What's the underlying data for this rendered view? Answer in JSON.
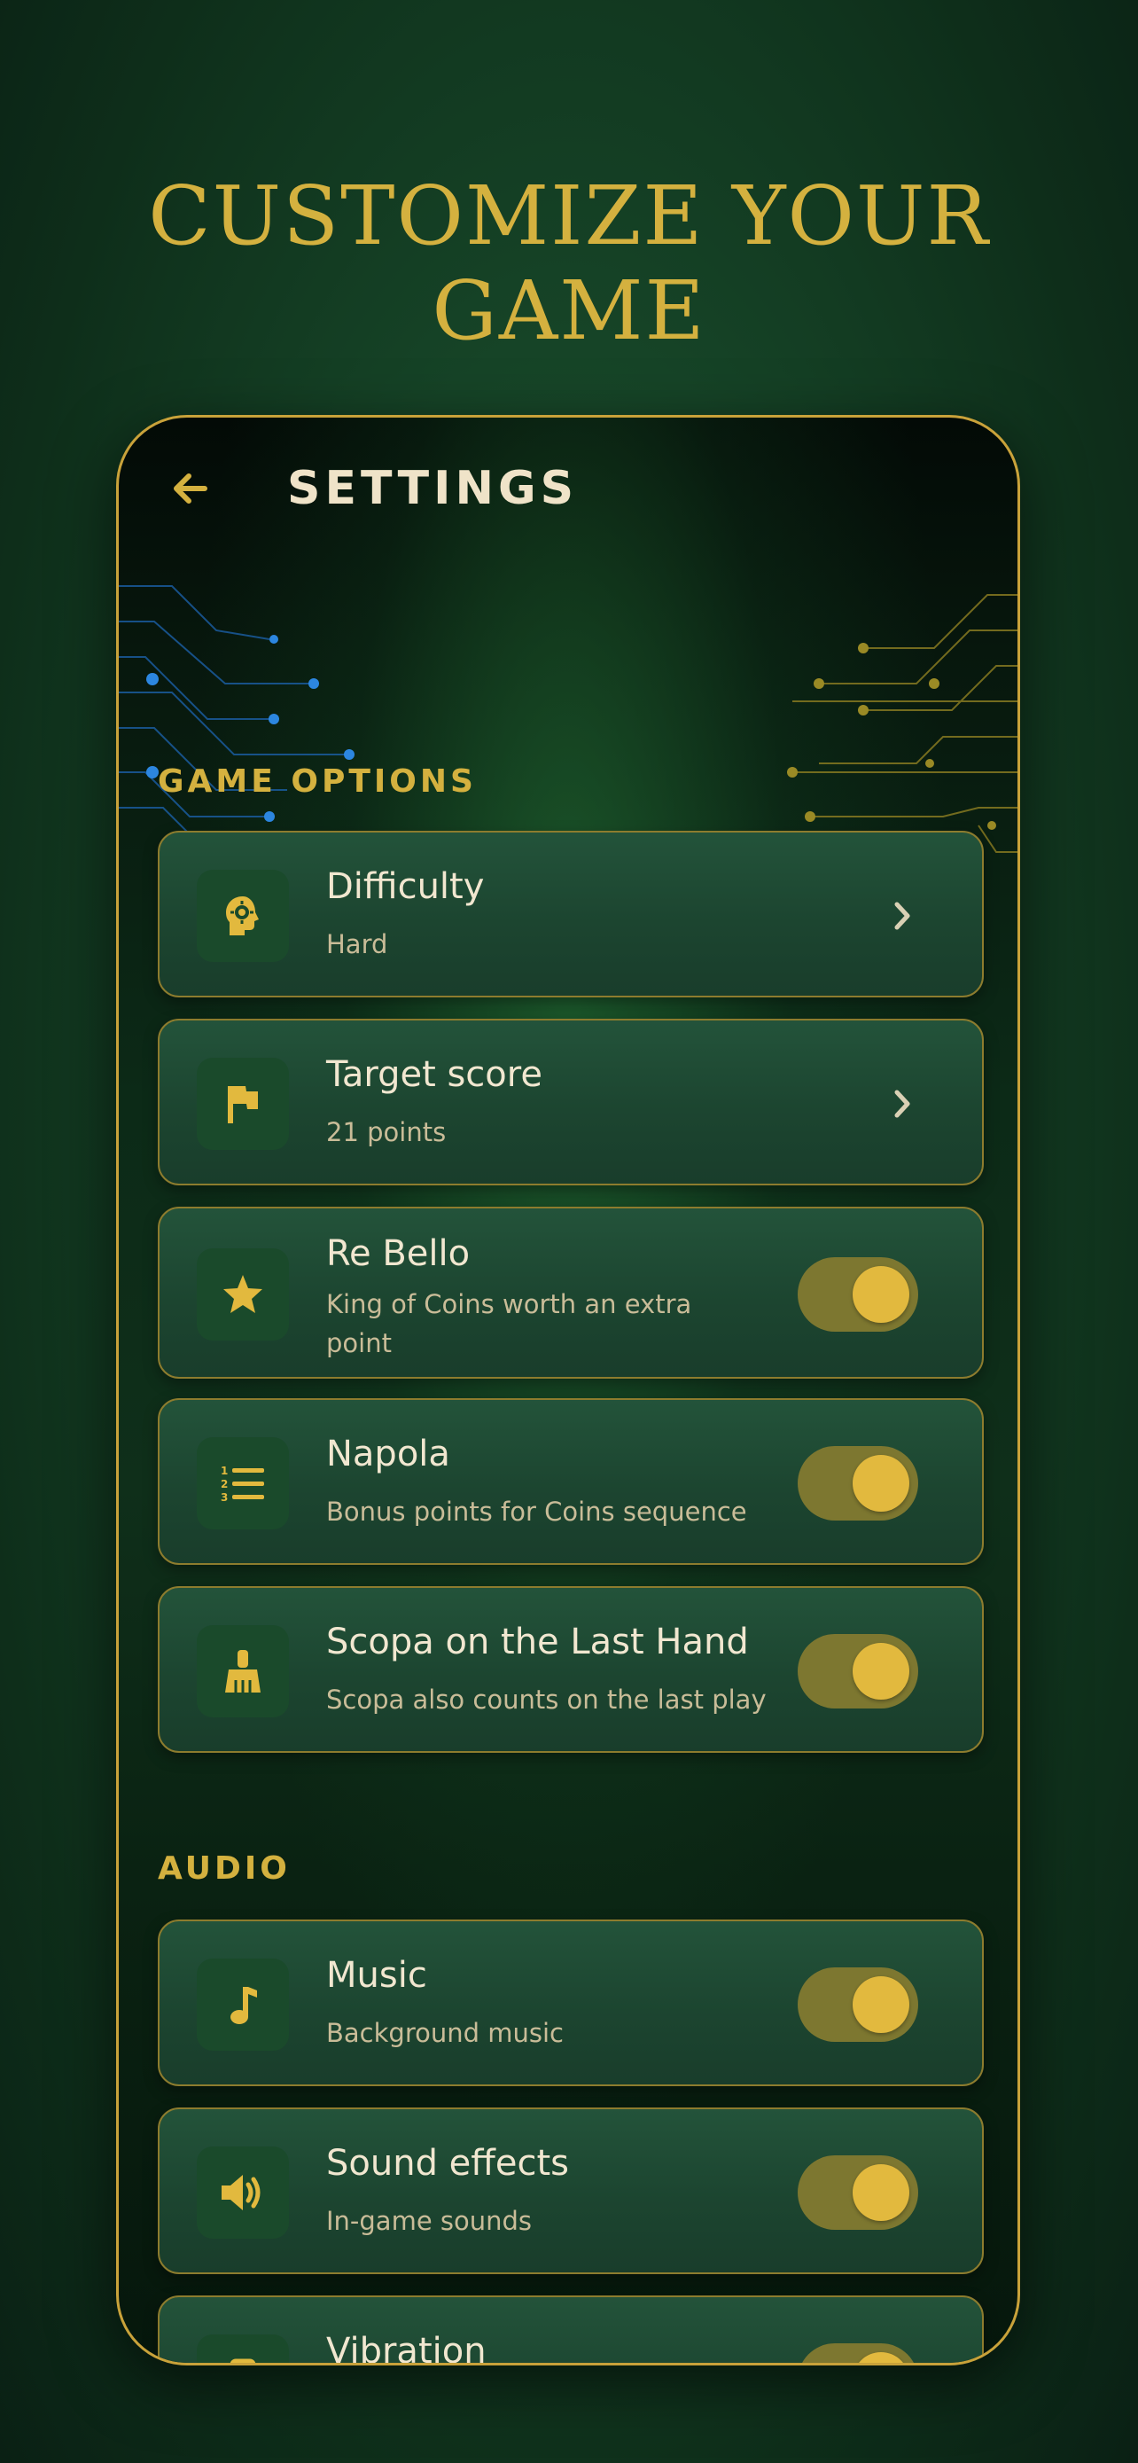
{
  "headline": "CUSTOMIZE YOUR GAME",
  "header": {
    "title": "SETTINGS",
    "back_icon": "arrow-left-icon"
  },
  "colors": {
    "accent": "#d4b13f",
    "card_border": "#8d7c2e",
    "toggle_track": "#7d7730"
  },
  "sections": {
    "game_options": {
      "title": "GAME OPTIONS",
      "items": [
        {
          "title": "Difficulty",
          "subtitle": "Hard",
          "icon": "brain-gear-icon",
          "control": "chevron"
        },
        {
          "title": "Target score",
          "subtitle": "21 points",
          "icon": "flag-icon",
          "control": "chevron"
        },
        {
          "title": "Re Bello",
          "subtitle": "King of Coins worth an extra point",
          "icon": "star-icon",
          "control": "toggle",
          "on": true
        },
        {
          "title": "Napola",
          "subtitle": "Bonus points for Coins sequence",
          "icon": "numbered-list-icon",
          "control": "toggle",
          "on": true
        },
        {
          "title": "Scopa on the Last Hand",
          "subtitle": "Scopa also counts on the last play",
          "icon": "broom-icon",
          "control": "toggle",
          "on": true
        }
      ]
    },
    "audio": {
      "title": "AUDIO",
      "items": [
        {
          "title": "Music",
          "subtitle": "Background music",
          "icon": "music-note-icon",
          "control": "toggle",
          "on": true
        },
        {
          "title": "Sound effects",
          "subtitle": "In-game sounds",
          "icon": "speaker-icon",
          "control": "toggle",
          "on": true
        },
        {
          "title": "Vibration",
          "subtitle": "",
          "icon": "phone-vibrate-icon",
          "control": "toggle",
          "on": true
        }
      ]
    }
  }
}
